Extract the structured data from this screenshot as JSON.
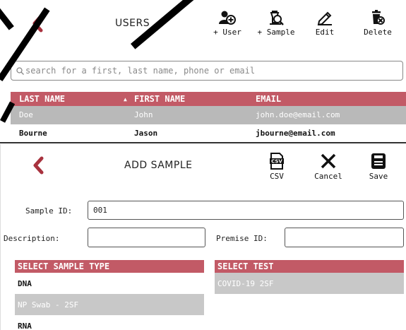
{
  "users_panel": {
    "title": "USERS",
    "toolbar": [
      {
        "label": "+ User",
        "icon": "add-user-icon"
      },
      {
        "label": "+ Sample",
        "icon": "add-sample-icon"
      },
      {
        "label": "Edit",
        "icon": "edit-icon"
      },
      {
        "label": "Delete",
        "icon": "delete-icon"
      }
    ],
    "search": {
      "placeholder": "search for a first, last name, phone or email"
    },
    "columns": [
      {
        "label": "LAST NAME",
        "sort": "ascending"
      },
      {
        "label": "FIRST NAME"
      },
      {
        "label": "EMAIL"
      }
    ],
    "rows": [
      {
        "last": "Doe",
        "first": "John",
        "email": "john.doe@email.com",
        "selected": true
      },
      {
        "last": "Bourne",
        "first": "Jason",
        "email": "jbourne@email.com",
        "selected": false
      }
    ]
  },
  "add_sample_panel": {
    "title": "ADD SAMPLE",
    "toolbar": [
      {
        "label": "CSV",
        "icon": "csv-file-icon"
      },
      {
        "label": "Cancel",
        "icon": "close-icon"
      },
      {
        "label": "Save",
        "icon": "save-icon"
      }
    ],
    "sample_id": {
      "label": "Sample ID:",
      "value": "001"
    },
    "description": {
      "label": "Description:",
      "value": ""
    },
    "premise_id": {
      "label": "Premise ID:",
      "value": ""
    },
    "sample_type": {
      "header": "SELECT SAMPLE TYPE",
      "options": [
        {
          "label": "DNA",
          "selected": false
        },
        {
          "label": "NP Swab - 2SF",
          "selected": true
        },
        {
          "label": "RNA",
          "selected": false
        }
      ]
    },
    "test": {
      "header": "SELECT TEST",
      "options": [
        {
          "label": "COVID-19 2SF",
          "selected": true
        }
      ]
    }
  },
  "colors": {
    "accent": "#c25a66",
    "back_arrow": "#a8323e",
    "selected_row": "#b9b9b9"
  }
}
